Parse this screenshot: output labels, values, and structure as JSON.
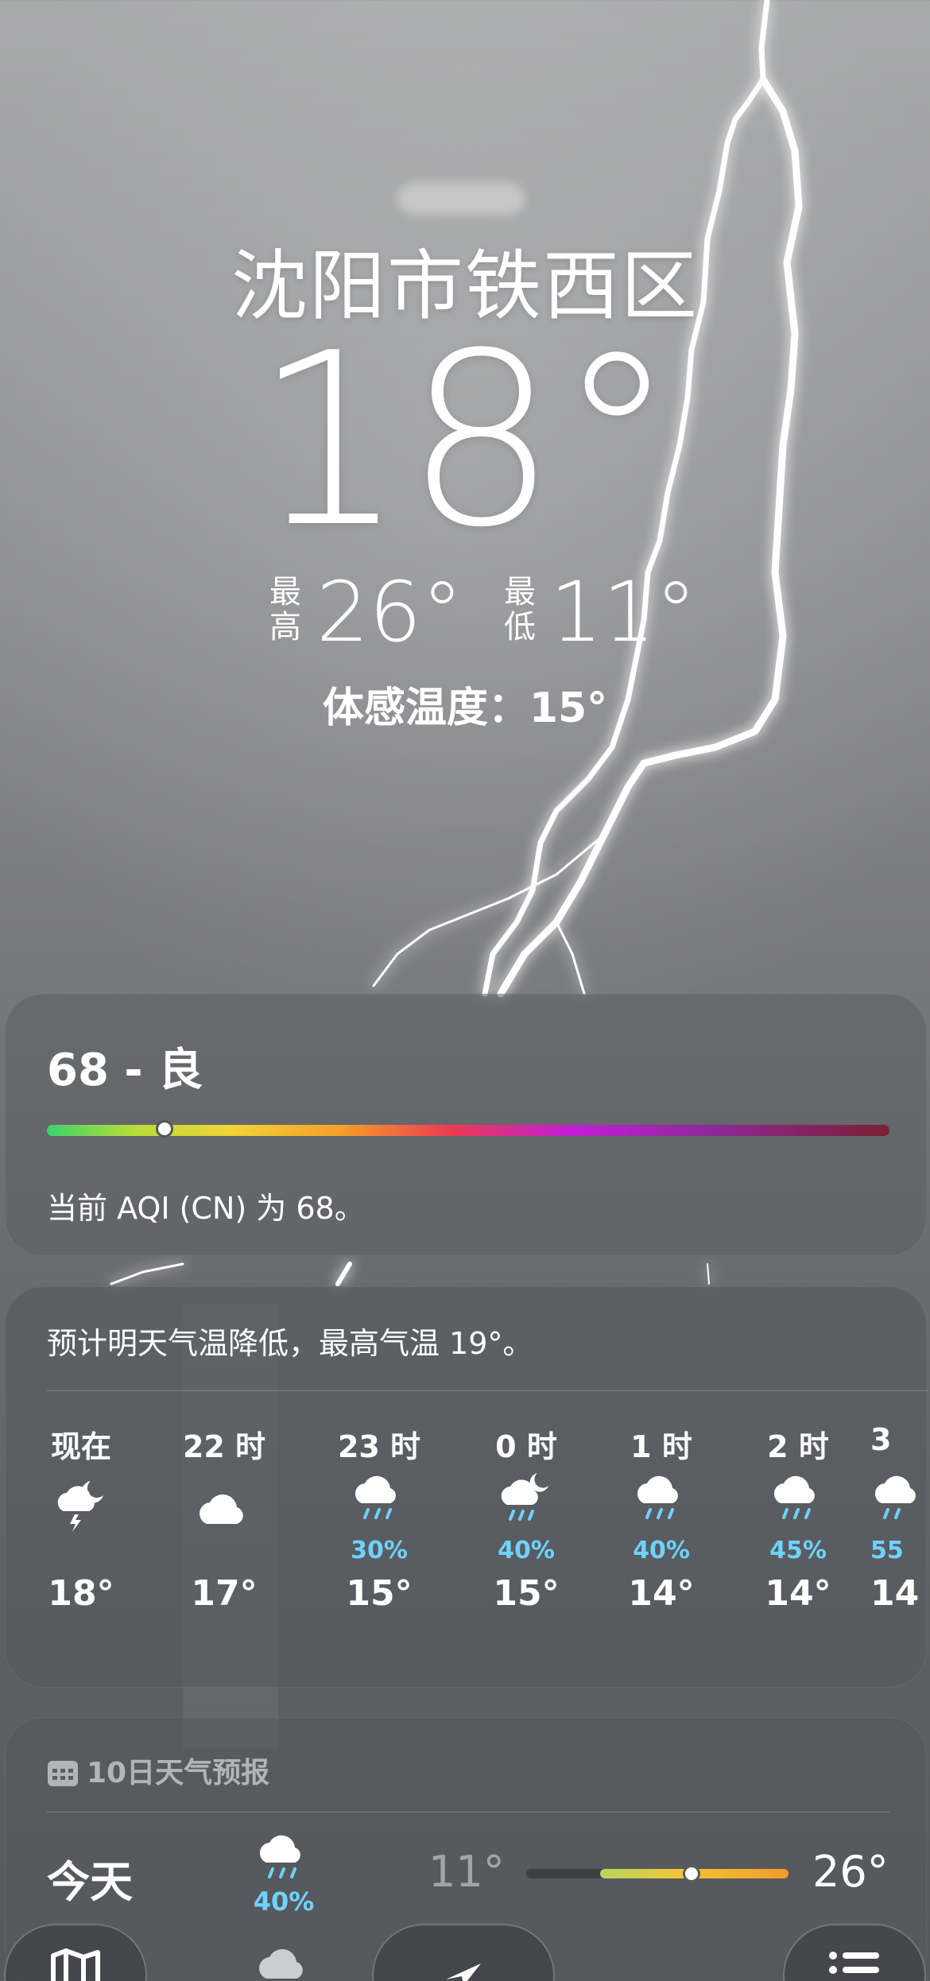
{
  "location": {
    "city": "沈阳市铁西区",
    "current_temp": "18°",
    "high_label": "最高",
    "high_value": "26°",
    "low_label": "最低",
    "low_value": "11°",
    "feels_like": "体感温度：15°"
  },
  "aqi": {
    "value_text": "68 - 良",
    "level": 68,
    "description": "当前 AQI (CN) 为 68。",
    "colors": [
      "#3ad36b",
      "#f2d335",
      "#f59e2a",
      "#ec3a52",
      "#c21fd6",
      "#7b1f33"
    ]
  },
  "hourly": {
    "summary": "预计明天气温降低，最高气温 19°。",
    "items": [
      {
        "time": "现在",
        "icon": "thunderstorm-night-icon",
        "pct": "",
        "temp": "18°"
      },
      {
        "time": "22 时",
        "icon": "cloud-icon",
        "pct": "",
        "temp": "17°"
      },
      {
        "time": "23 时",
        "icon": "rain-cloud-icon",
        "pct": "30%",
        "temp": "15°"
      },
      {
        "time": "0 时",
        "icon": "rain-night-icon",
        "pct": "40%",
        "temp": "15°"
      },
      {
        "time": "1 时",
        "icon": "rain-cloud-icon",
        "pct": "40%",
        "temp": "14°"
      },
      {
        "time": "2 时",
        "icon": "rain-cloud-icon",
        "pct": "45%",
        "temp": "14°"
      },
      {
        "time": "3",
        "icon": "rain-cloud-icon",
        "pct": "55",
        "temp": "14"
      }
    ]
  },
  "daily": {
    "header": "10日天气预报",
    "items": [
      {
        "day": "今天",
        "icon": "rain-cloud-icon",
        "pct": "40%",
        "low": "11°",
        "high": "26°"
      }
    ]
  },
  "tabbar": {
    "map_icon": "map-icon",
    "location_icon": "location-arrow-icon",
    "list_icon": "list-icon"
  }
}
